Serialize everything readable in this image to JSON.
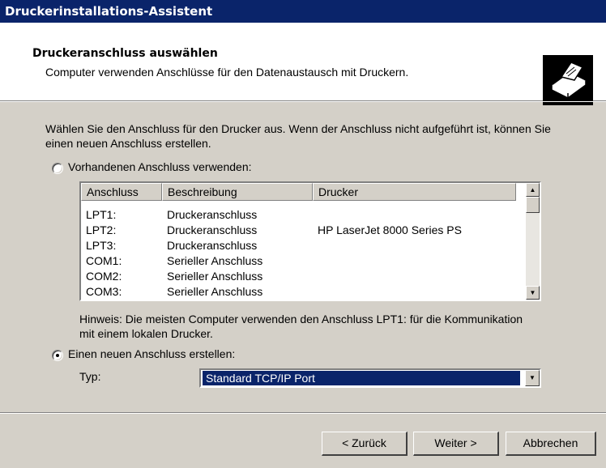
{
  "window": {
    "title": "Druckerinstallations-Assistent"
  },
  "header": {
    "title": "Druckeranschluss auswählen",
    "subtitle": "Computer verwenden Anschlüsse für den Datenaustausch mit Druckern.",
    "icon": "printer-icon"
  },
  "intro": "Wählen Sie den Anschluss für den Drucker aus. Wenn der Anschluss nicht aufgeführt ist, können Sie einen neuen Anschluss erstellen.",
  "existing_port": {
    "label": "Vorhandenen Anschluss verwenden:",
    "selected": false
  },
  "port_list": {
    "columns": [
      "Anschluss",
      "Beschreibung",
      "Drucker"
    ],
    "rows": [
      [
        "LPT1:",
        "Druckeranschluss",
        ""
      ],
      [
        "LPT2:",
        "Druckeranschluss",
        "HP LaserJet 8000 Series PS"
      ],
      [
        "LPT3:",
        "Druckeranschluss",
        ""
      ],
      [
        "COM1:",
        "Serieller Anschluss",
        ""
      ],
      [
        "COM2:",
        "Serieller Anschluss",
        ""
      ],
      [
        "COM3:",
        "Serieller Anschluss",
        ""
      ]
    ]
  },
  "hint": "Hinweis: Die meisten Computer verwenden den Anschluss LPT1: für die Kommunikation mit einem lokalen Drucker.",
  "new_port": {
    "label": "Einen neuen Anschluss erstellen:",
    "selected": true,
    "type_label": "Typ:",
    "type_value": "Standard TCP/IP Port"
  },
  "buttons": {
    "back": "< Zurück",
    "next": "Weiter >",
    "cancel": "Abbrechen"
  }
}
